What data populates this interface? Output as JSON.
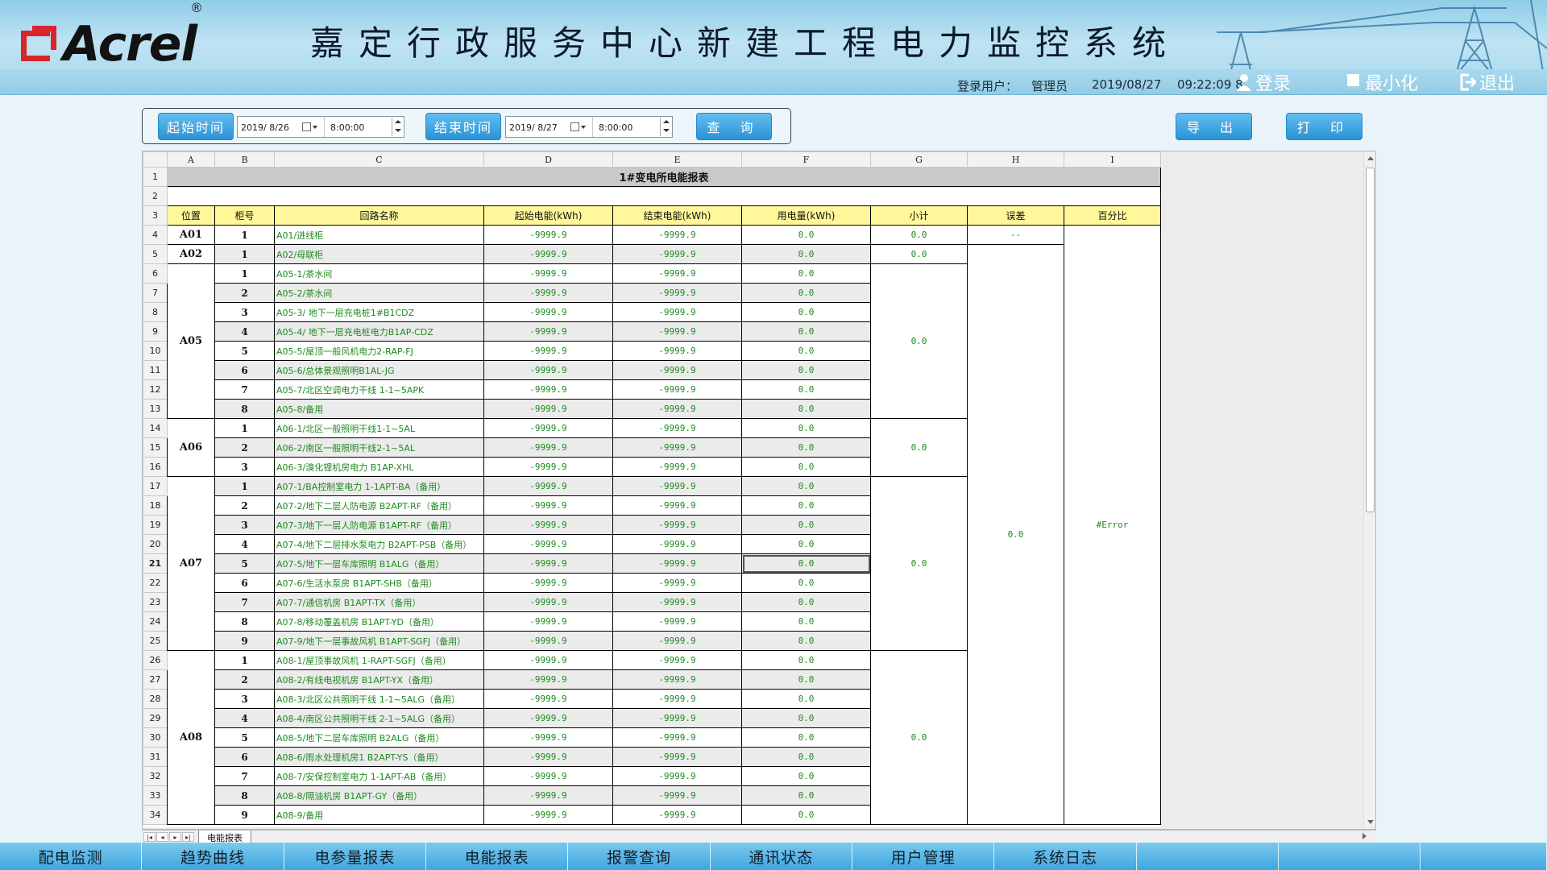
{
  "header": {
    "logo_text": "Acrel",
    "logo_reg": "®",
    "title": "嘉定行政服务中心新建工程电力监控系统",
    "login_user_label": "登录用户：",
    "login_user": "管理员",
    "date": "2019/08/27",
    "time": "09:22:09 8",
    "login_button": "登录",
    "minimize_button": "最小化",
    "exit_button": "退出"
  },
  "query": {
    "start_label": "起始时间",
    "start_date": "2019/ 8/26",
    "start_time": "8:00:00",
    "end_label": "结束时间",
    "end_date": "2019/ 8/27",
    "end_time": "8:00:00",
    "query_button": "查 询",
    "export_button": "导 出",
    "print_button": "打 印"
  },
  "sheet": {
    "columns": [
      "A",
      "B",
      "C",
      "D",
      "E",
      "F",
      "G",
      "H",
      "I"
    ],
    "title": "1#变电所电能报表",
    "headers": [
      "位置",
      "柜号",
      "回路名称",
      "起始电能(kWh)",
      "结束电能(kWh)",
      "用电量(kWh)",
      "小计",
      "误差",
      "百分比"
    ],
    "start_energy": "-9999.9",
    "end_energy": "-9999.9",
    "usage": "0.0",
    "groups": [
      {
        "pos": "A01",
        "subtotal": "0.0",
        "rows": [
          {
            "no": "1",
            "name": "A01/进线柜"
          }
        ]
      },
      {
        "pos": "A02",
        "subtotal": "0.0",
        "rows": [
          {
            "no": "1",
            "name": "A02/母联柜"
          }
        ]
      },
      {
        "pos": "A05",
        "subtotal": "0.0",
        "rows": [
          {
            "no": "1",
            "name": "A05-1/茶水间"
          },
          {
            "no": "2",
            "name": "A05-2/茶水间"
          },
          {
            "no": "3",
            "name": "A05-3/ 地下一层充电桩1#B1CDZ"
          },
          {
            "no": "4",
            "name": "A05-4/ 地下一层充电桩电力B1AP-CDZ"
          },
          {
            "no": "5",
            "name": "A05-5/屋顶一般风机电力2-RAP-FJ"
          },
          {
            "no": "6",
            "name": "A05-6/总体景观照明B1AL-JG"
          },
          {
            "no": "7",
            "name": "A05-7/北区空调电力干线 1-1~5APK"
          },
          {
            "no": "8",
            "name": "A05-8/备用"
          }
        ]
      },
      {
        "pos": "A06",
        "subtotal": "0.0",
        "rows": [
          {
            "no": "1",
            "name": "A06-1/北区一般照明干线1-1~5AL"
          },
          {
            "no": "2",
            "name": "A06-2/南区一般照明干线2-1~5AL"
          },
          {
            "no": "3",
            "name": "A06-3/溴化锂机房电力 B1AP-XHL"
          }
        ]
      },
      {
        "pos": "A07",
        "subtotal": "0.0",
        "rows": [
          {
            "no": "1",
            "name": "A07-1/BA控制室电力 1-1APT-BA（备用）"
          },
          {
            "no": "2",
            "name": "A07-2/地下二层人防电源 B2APT-RF（备用）"
          },
          {
            "no": "3",
            "name": "A07-3/地下一层人防电源 B1APT-RF（备用）"
          },
          {
            "no": "4",
            "name": "A07-4/地下二层排水泵电力 B2APT-PSB（备用）"
          },
          {
            "no": "5",
            "name": "A07-5/地下一层车库照明 B1ALG（备用）"
          },
          {
            "no": "6",
            "name": "A07-6/生活水泵房 B1APT-SHB（备用）"
          },
          {
            "no": "7",
            "name": "A07-7/通信机房 B1APT-TX（备用）"
          },
          {
            "no": "8",
            "name": "A07-8/移动覆盖机房 B1APT-YD（备用）"
          },
          {
            "no": "9",
            "name": "A07-9/地下一层事故风机 B1APT-SGFJ（备用）"
          }
        ]
      },
      {
        "pos": "A08",
        "subtotal": "0.0",
        "rows": [
          {
            "no": "1",
            "name": "A08-1/屋顶事故风机 1-RAPT-SGFJ（备用）"
          },
          {
            "no": "2",
            "name": "A08-2/有线电视机房 B1APT-YX（备用）"
          },
          {
            "no": "3",
            "name": "A08-3/北区公共照明干线 1-1~5ALG（备用）"
          },
          {
            "no": "4",
            "name": "A08-4/南区公共照明干线 2-1~5ALG（备用）"
          },
          {
            "no": "5",
            "name": "A08-5/地下二层车库照明 B2ALG（备用）"
          },
          {
            "no": "6",
            "name": "A08-6/雨水处理机房1 B2APT-YS（备用）"
          },
          {
            "no": "7",
            "name": "A08-7/安保控制室电力 1-1APT-AB（备用）"
          },
          {
            "no": "8",
            "name": "A08-8/隔油机房 B1APT-GY（备用）"
          },
          {
            "no": "9",
            "name": "A08-9/备用"
          }
        ]
      }
    ],
    "error_top": "--",
    "error_total": "0.0",
    "percent": "#Error",
    "tab_name": "电能报表"
  },
  "nav": {
    "tabs": [
      "配电监测",
      "趋势曲线",
      "电参量报表",
      "电能报表",
      "报警查询",
      "通讯状态",
      "用户管理",
      "系统日志",
      "",
      "",
      ""
    ]
  },
  "colors": {
    "header_bg": "#a6d7ec",
    "title_row_bg": "#c9c9c9",
    "header_row_bg": "#fff799",
    "value_text": "#1f8a1f",
    "button_blue": "#2a93d6"
  }
}
